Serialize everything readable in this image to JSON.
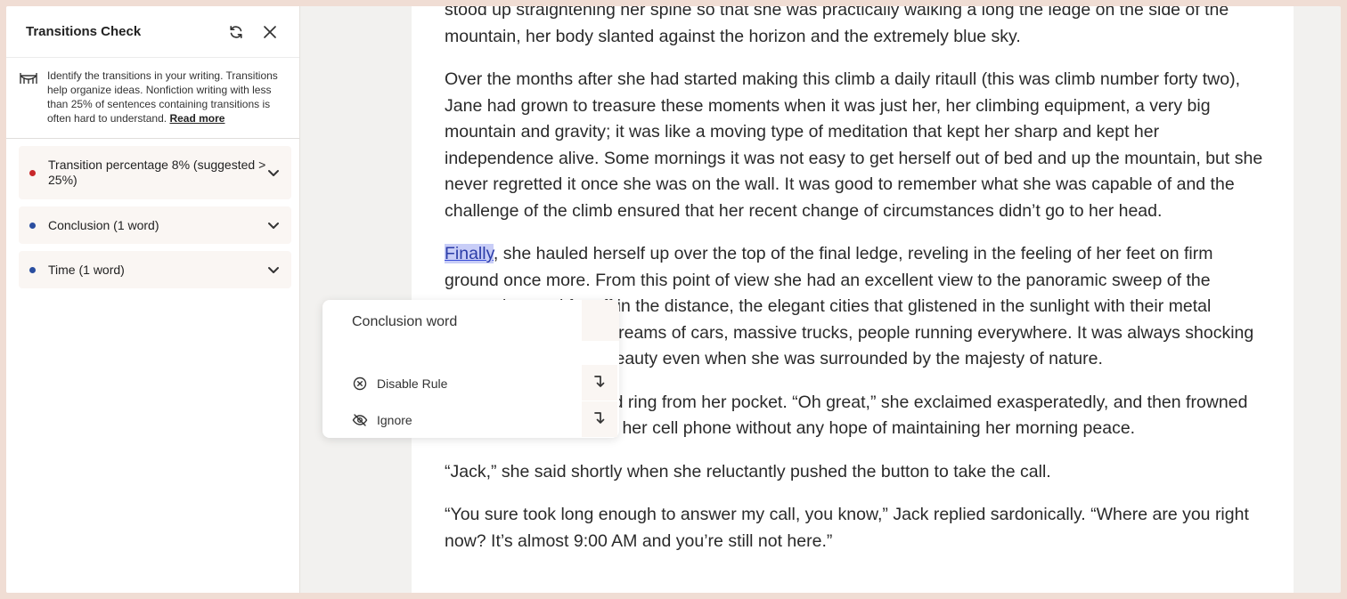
{
  "sidebar": {
    "title": "Transitions Check",
    "description": "Identify the transitions in your writing. Transitions help organize ideas. Nonfiction writing with less than 25% of sentences containing transitions is often hard to understand.",
    "read_more": "Read more",
    "items": [
      {
        "label": "Transition percentage 8% (suggested > 25%)",
        "dot_color": "#c8272a"
      },
      {
        "label": "Conclusion (1 word)",
        "dot_color": "#2a4ea0"
      },
      {
        "label": "Time (1 word)",
        "dot_color": "#2a4ea0"
      }
    ]
  },
  "document": {
    "p1": "stood up straightening her spine so that she was practically walking a long the ledge on the side of the mountain, her body slanted against  the horizon and the extremely blue sky.",
    "p2": "Over the months after she had started making this climb a daily ritaull (this was climb number forty two), Jane had grown to treasure these moments when it was just her, her climbing equipment, a very big mountain and gravity; it was like a moving type of meditation that kept her sharp and kept her independence alive. Some mornings it was not easy to get herself out of bed and up the mountain, but she never regretted it once she was on the wall. It was good to remember what she was capable of and the challenge of the climb ensured that her recent change of circumstances didn’t go to her head.",
    "p3_highlight": "Finally",
    "p3_rest": ", she hauled herself up over the top of the final ledge, reveling in the feeling of her feet on firm ground once more. From this point of view she had an excellent view to the panoramic sweep of the mountains, and far off in the distance, the elegant cities that glistened in the sunlight with their metal towers and constant streams of cars, massive trucks, people running everywhere. It was always shocking to her in it’s extreme beauty even when she was surrounded by the majesty of nature.",
    "p4": "There was a shrill, loud ring from her pocket. “Oh great,” she exclaimed exasperatedly, and then frowned as she looked down at her cell phone without any hope of maintaining her morning peace.",
    "p5": "“Jack,” she said shortly when she reluctantly pushed the button to take the call.",
    "p6": "“You sure took long enough to answer my call, you know,” Jack replied sardonically. “Where are you right now? It’s almost 9:00 AM and you’re still not here.”"
  },
  "popup": {
    "title": "Conclusion word",
    "disable_rule": "Disable Rule",
    "ignore": "Ignore"
  }
}
